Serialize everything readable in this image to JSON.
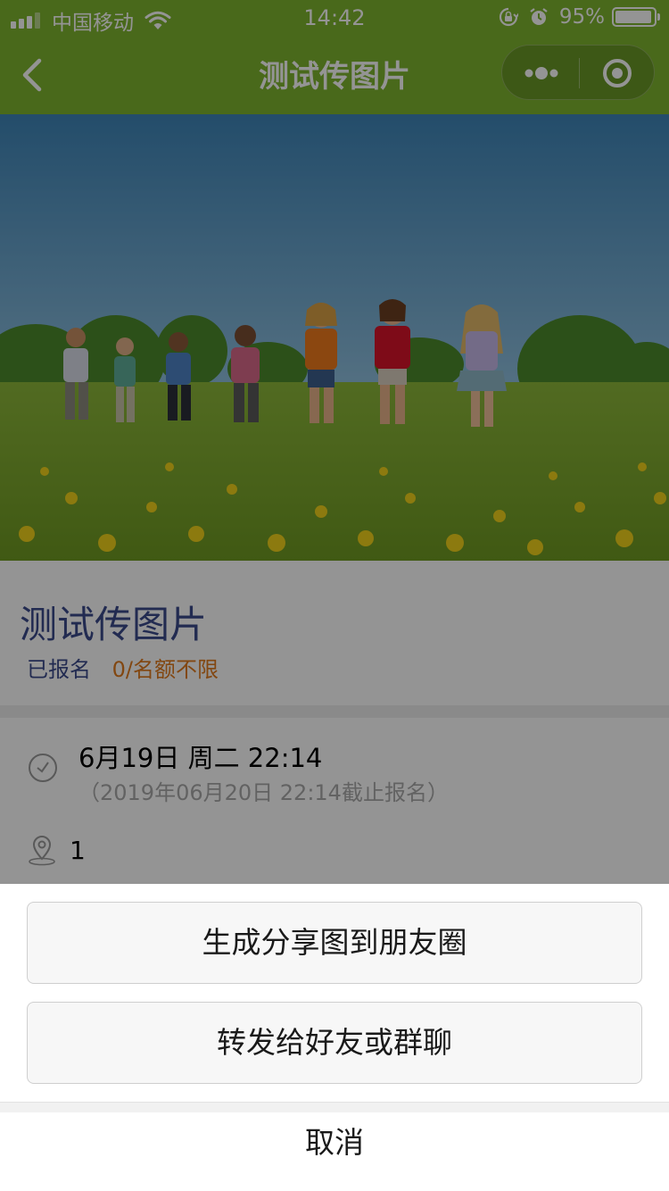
{
  "status_bar": {
    "carrier": "中国移动",
    "time": "14:42",
    "battery_percent": "95%",
    "battery_level": 0.95,
    "icons": [
      "signal-icon",
      "wifi-icon",
      "rotation-lock-icon",
      "alarm-icon",
      "battery-icon"
    ]
  },
  "navbar": {
    "title": "测试传图片",
    "back_icon": "chevron-left-icon",
    "more_icon": "more-dots-icon",
    "close_icon": "miniprogram-close-icon"
  },
  "activity": {
    "title": "测试传图片",
    "signup_label": "已报名",
    "signup_count": "0/名额不限",
    "date": "6月19日 周二 22:14",
    "deadline": "（2019年06月20日 22:14截止报名）",
    "location": "1"
  },
  "action_sheet": {
    "share_moments_label": "生成分享图到朋友圈",
    "forward_label": "转发给好友或群聊",
    "cancel_label": "取消"
  },
  "colors": {
    "brand_green": "#7fb52f",
    "title_blue": "#3c4a8c",
    "count_orange": "#e17a1e"
  }
}
